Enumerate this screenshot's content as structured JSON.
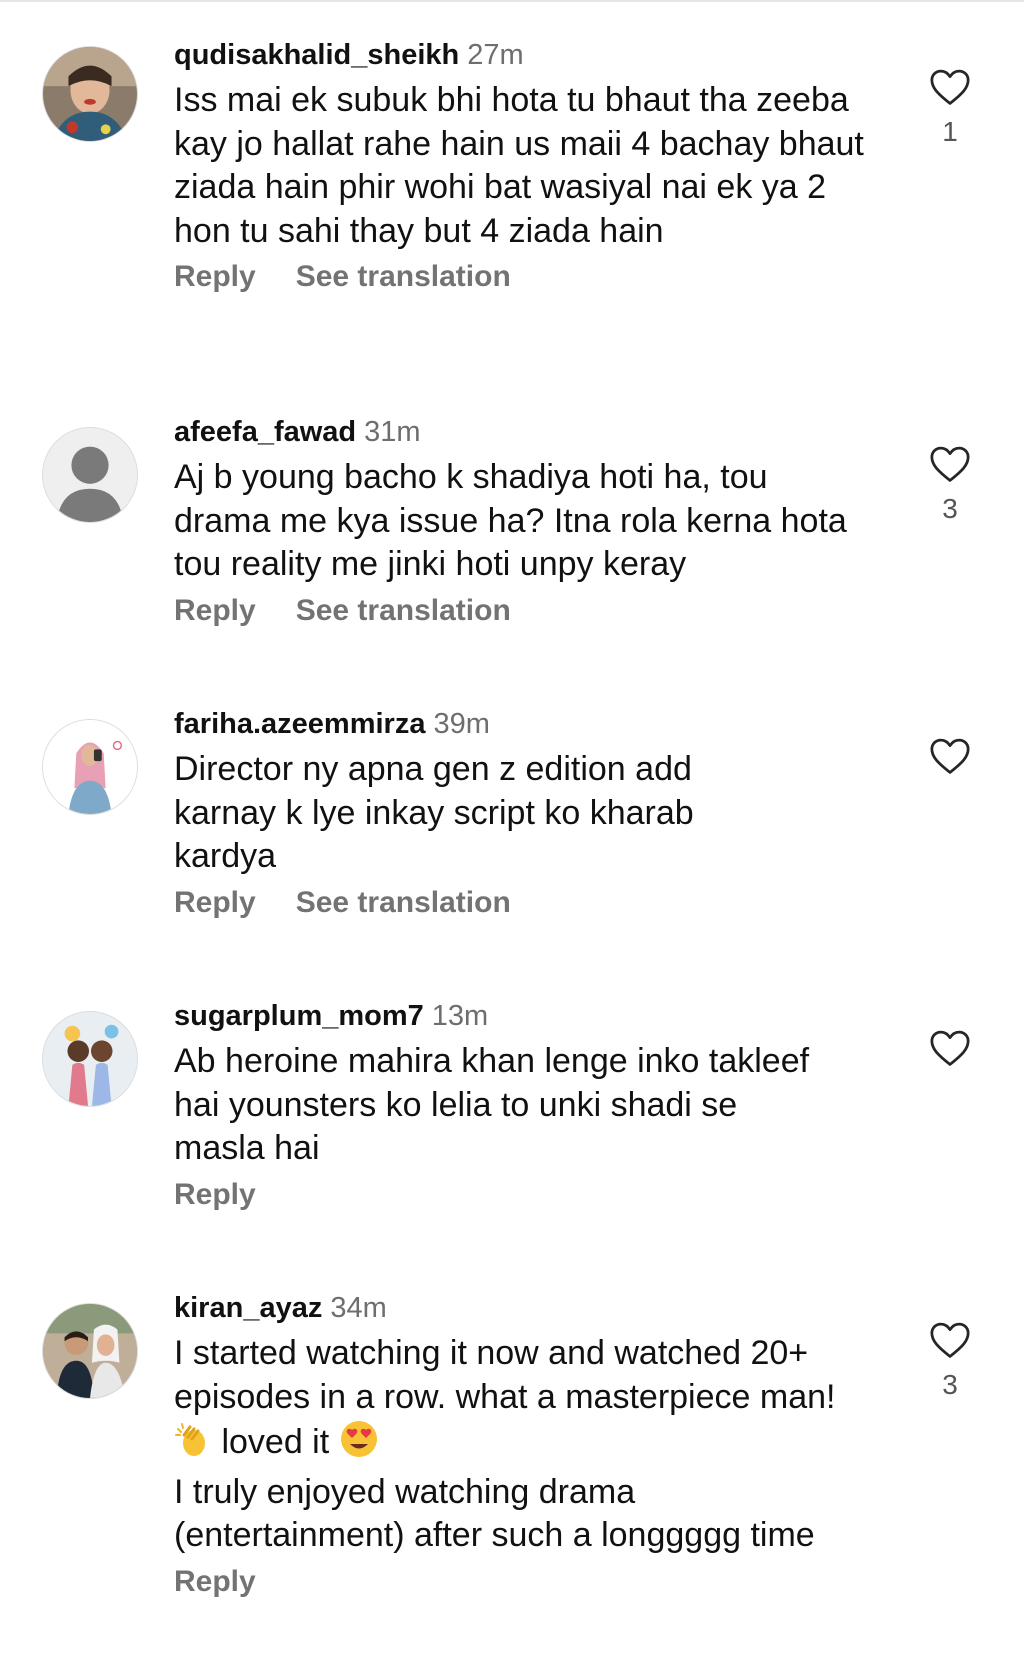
{
  "comments": [
    {
      "username": "qudisakhalid_sheikh",
      "time": "27m",
      "text": "Iss mai ek subuk bhi hota tu bhaut tha zeeba kay jo hallat rahe hain us maii 4 bachay bhaut ziada hain phir wohi bat wasiyal nai ek ya 2 hon tu sahi thay but 4 ziada hain",
      "reply": "Reply",
      "translation": "See translation",
      "likes": "1"
    },
    {
      "username": "afeefa_fawad",
      "time": "31m",
      "text": "Aj b young bacho k shadiya hoti ha, tou drama me kya issue ha? Itna rola kerna hota tou reality me jinki hoti unpy keray",
      "reply": "Reply",
      "translation": "See translation",
      "likes": "3"
    },
    {
      "username": "fariha.azeemmirza",
      "time": "39m",
      "text": "Director ny apna gen z edition add karnay k lye inkay script ko kharab kardya",
      "reply": "Reply",
      "translation": "See translation",
      "likes": ""
    },
    {
      "username": "sugarplum_mom7",
      "time": "13m",
      "text": "Ab heroine mahira khan lenge inko takleef hai younsters ko lelia to unki shadi se masla hai",
      "reply": "Reply",
      "likes": ""
    },
    {
      "username": "kiran_ayaz",
      "time": "34m",
      "text_line1": "I started watching it now and watched 20+ episodes in a row. what a masterpiece man!",
      "text_mid": "loved it",
      "text_line2": "I truly enjoyed watching drama (entertainment) after such a longgggg time",
      "emojis": [
        "clapping-hands-icon",
        "heart-eyes-icon"
      ],
      "reply": "Reply",
      "likes": "3"
    }
  ],
  "colors": {
    "username": "#111111",
    "meta": "#6e6e6e",
    "action": "#737373",
    "heart_outline": "#262626"
  }
}
